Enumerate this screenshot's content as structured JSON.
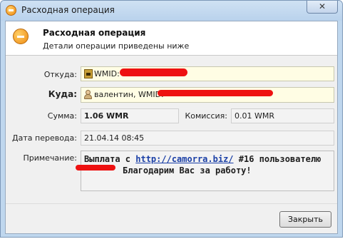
{
  "window": {
    "title": "Расходная операция",
    "close_glyph": "✕"
  },
  "header": {
    "title": "Расходная операция",
    "subtitle": "Детали операции приведены ниже"
  },
  "fields": {
    "from_label": "Откуда:",
    "from_value": "WMID:",
    "to_label": "Куда:",
    "to_value": "валентин, WMID:",
    "amount_label": "Сумма:",
    "amount_value": "1.06 WMR",
    "commission_label": "Комиссия:",
    "commission_value": "0.01 WMR",
    "date_label": "Дата перевода:",
    "date_value": "21.04.14 08:45",
    "note_label": "Примечание:"
  },
  "note": {
    "part1": "Выплата с ",
    "link": "http://camorra.biz/",
    "part2": " #16 пользователю",
    "part3": "Благодарим Вас за работу!"
  },
  "footer": {
    "close_button": "Закрыть"
  },
  "icons": {
    "app": "operation-icon",
    "header": "operation-icon",
    "from": "purse-icon",
    "to": "user-icon"
  },
  "colors": {
    "redaction": "#ee1111",
    "link": "#1a3fa6",
    "field_bg": "#fffde4"
  }
}
